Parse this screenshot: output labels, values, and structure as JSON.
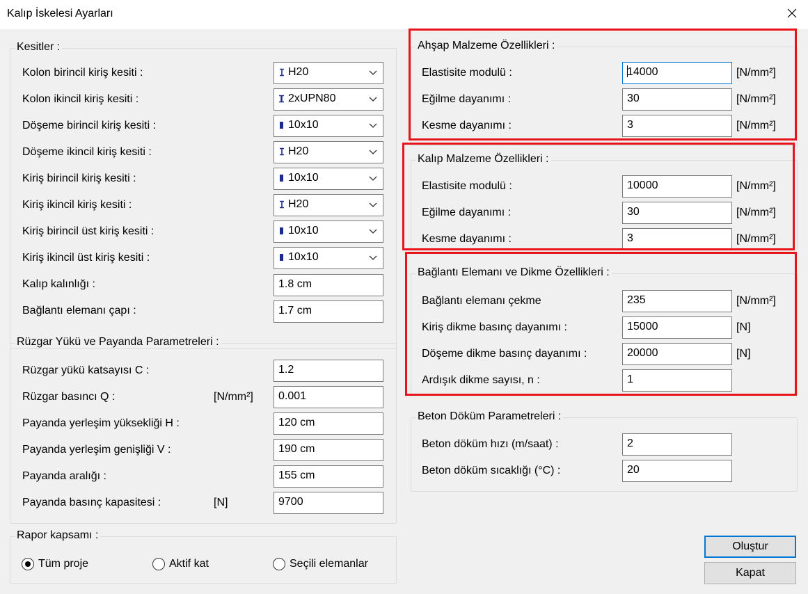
{
  "window": {
    "title": "Kalıp İskelesi Ayarları"
  },
  "sections": {
    "kesitler": {
      "title": "Kesitler :",
      "rows": [
        {
          "label": "Kolon birincil kiriş kesiti :",
          "value": "H20",
          "icon": "i-beam-icon"
        },
        {
          "label": "Kolon ikincil kiriş kesiti :",
          "value": "2xUPN80",
          "icon": "double-channel-icon"
        },
        {
          "label": "Döşeme birincil kiriş kesiti :",
          "value": "10x10",
          "icon": "rectangle-section-icon"
        },
        {
          "label": "Döşeme ikincil kiriş kesiti :",
          "value": "H20",
          "icon": "i-beam-icon"
        },
        {
          "label": "Kiriş birincil kiriş kesiti :",
          "value": "10x10",
          "icon": "rectangle-section-icon"
        },
        {
          "label": "Kiriş ikincil kiriş kesiti :",
          "value": "H20",
          "icon": "i-beam-icon"
        },
        {
          "label": "Kiriş birincil üst kiriş kesiti :",
          "value": "10x10",
          "icon": "rectangle-section-icon"
        },
        {
          "label": "Kiriş ikincil üst kiriş kesiti :",
          "value": "10x10",
          "icon": "rectangle-section-icon"
        }
      ],
      "fields": [
        {
          "label": "Kalıp kalınlığı :",
          "value": "1.8 cm"
        },
        {
          "label": "Bağlantı elemanı çapı :",
          "value": "1.7 cm"
        }
      ]
    },
    "ruzgar": {
      "title": "Rüzgar Yükü ve Payanda Parametreleri :",
      "rows": [
        {
          "label": "Rüzgar yükü katsayısı C :",
          "unit": "",
          "value": "1.2"
        },
        {
          "label": "Rüzgar basıncı Q :",
          "unit": "[N/mm²]",
          "value": "0.001"
        },
        {
          "label": "Payanda yerleşim yüksekliği H :",
          "unit": "",
          "value": "120 cm"
        },
        {
          "label": "Payanda yerleşim genişliği V :",
          "unit": "",
          "value": "190 cm"
        },
        {
          "label": "Payanda aralığı :",
          "unit": "",
          "value": "155 cm"
        },
        {
          "label": "Payanda basınç kapasitesi :",
          "unit": "[N]",
          "value": "9700"
        }
      ]
    },
    "rapor": {
      "title": "Rapor kapsamı :",
      "options": [
        {
          "label": "Tüm proje",
          "selected": true
        },
        {
          "label": "Aktif kat",
          "selected": false
        },
        {
          "label": "Seçili elemanlar",
          "selected": false
        }
      ]
    },
    "ahsap": {
      "title": "Ahşap Malzeme Özellikleri :",
      "rows": [
        {
          "label": "Elastisite modulü :",
          "value": "14000",
          "unit": "[N/mm²]"
        },
        {
          "label": "Eğilme dayanımı :",
          "value": "30",
          "unit": "[N/mm²]"
        },
        {
          "label": "Kesme dayanımı :",
          "value": "3",
          "unit": "[N/mm²]"
        }
      ]
    },
    "kalip": {
      "title": "Kalıp Malzeme Özellikleri :",
      "rows": [
        {
          "label": "Elastisite modulü :",
          "value": "10000",
          "unit": "[N/mm²]"
        },
        {
          "label": "Eğilme dayanımı :",
          "value": "30",
          "unit": "[N/mm²]"
        },
        {
          "label": "Kesme dayanımı :",
          "value": "3",
          "unit": "[N/mm²]"
        }
      ]
    },
    "baglanti": {
      "title": "Bağlantı Elemanı ve Dikme Özellikleri :",
      "rows": [
        {
          "label": "Bağlantı elemanı çekme",
          "value": "235",
          "unit": "[N/mm²]"
        },
        {
          "label": "Kiriş dikme basınç dayanımı :",
          "value": "15000",
          "unit": "[N]"
        },
        {
          "label": "Döşeme dikme basınç dayanımı :",
          "value": "20000",
          "unit": "[N]"
        },
        {
          "label": "Ardışık dikme sayısı, n :",
          "value": "1",
          "unit": ""
        }
      ]
    },
    "beton": {
      "title": "Beton Döküm Parametreleri :",
      "rows": [
        {
          "label": "Beton döküm hızı (m/saat) :",
          "value": "2"
        },
        {
          "label": "Beton döküm sıcaklığı (°C) :",
          "value": "20"
        }
      ]
    }
  },
  "buttons": {
    "create": "Oluştur",
    "close": "Kapat"
  },
  "colors": {
    "accent": "#0078d7",
    "highlight": "#e8131b",
    "dialog_bg": "#f0f0f0"
  }
}
